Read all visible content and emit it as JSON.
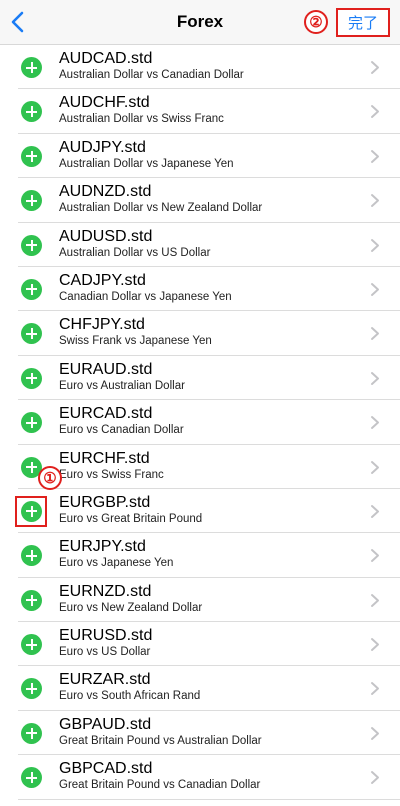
{
  "navbar": {
    "title": "Forex",
    "done_label": "完了",
    "back_icon": "chevron-left-icon",
    "accent_color": "#1a7cf5"
  },
  "annotations": {
    "step1": "①",
    "step2": "②",
    "color": "#e0201d"
  },
  "symbols": [
    {
      "symbol": "AUDCAD.std",
      "desc": "Australian Dollar vs Canadian Dollar"
    },
    {
      "symbol": "AUDCHF.std",
      "desc": "Australian Dollar vs Swiss Franc"
    },
    {
      "symbol": "AUDJPY.std",
      "desc": "Australian Dollar vs Japanese Yen"
    },
    {
      "symbol": "AUDNZD.std",
      "desc": "Australian Dollar vs New Zealand Dollar"
    },
    {
      "symbol": "AUDUSD.std",
      "desc": "Australian Dollar vs US Dollar"
    },
    {
      "symbol": "CADJPY.std",
      "desc": "Canadian Dollar vs Japanese Yen"
    },
    {
      "symbol": "CHFJPY.std",
      "desc": "Swiss Frank vs Japanese Yen"
    },
    {
      "symbol": "EURAUD.std",
      "desc": "Euro vs Australian Dollar"
    },
    {
      "symbol": "EURCAD.std",
      "desc": "Euro vs Canadian Dollar"
    },
    {
      "symbol": "EURCHF.std",
      "desc": "Euro vs Swiss Franc"
    },
    {
      "symbol": "EURGBP.std",
      "desc": "Euro vs Great Britain Pound"
    },
    {
      "symbol": "EURJPY.std",
      "desc": "Euro vs Japanese Yen"
    },
    {
      "symbol": "EURNZD.std",
      "desc": "Euro vs New Zealand Dollar"
    },
    {
      "symbol": "EURUSD.std",
      "desc": "Euro vs US Dollar"
    },
    {
      "symbol": "EURZAR.std",
      "desc": "Euro vs South African Rand"
    },
    {
      "symbol": "GBPAUD.std",
      "desc": "Great Britain Pound vs Australian Dollar"
    },
    {
      "symbol": "GBPCAD.std",
      "desc": "Great Britain Pound vs Canadian Dollar"
    }
  ],
  "icons": {
    "add": "plus-circle-icon",
    "row_chevron": "chevron-right-icon",
    "add_color": "#30c24f"
  }
}
